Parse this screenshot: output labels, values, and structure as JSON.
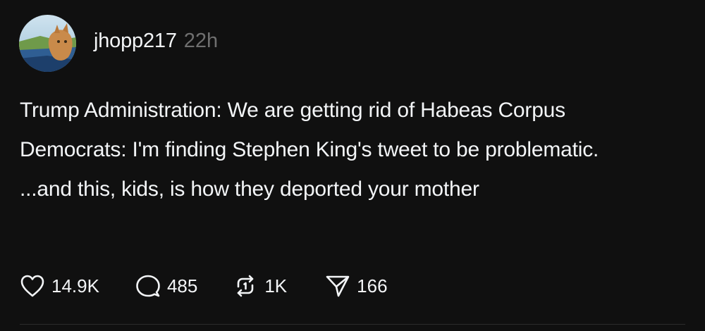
{
  "post": {
    "username": "jhopp217",
    "timestamp": "22h",
    "avatar_icon": "user-avatar-photo",
    "paragraphs": [
      "Trump Administration: We are getting rid of Habeas Corpus",
      "Democrats: I'm finding Stephen King's tweet to be problematic.",
      "...and this, kids, is how they deported your mother"
    ],
    "actions": {
      "like": {
        "icon": "heart-icon",
        "count": "14.9K"
      },
      "reply": {
        "icon": "comment-bubble-icon",
        "count": "485"
      },
      "repost": {
        "icon": "repost-icon",
        "count": "1K"
      },
      "share": {
        "icon": "send-icon",
        "count": "166"
      }
    }
  },
  "colors": {
    "background": "#101010",
    "text": "#f3f5f7",
    "muted": "#6f6f6f",
    "divider": "#2b2b2b"
  }
}
